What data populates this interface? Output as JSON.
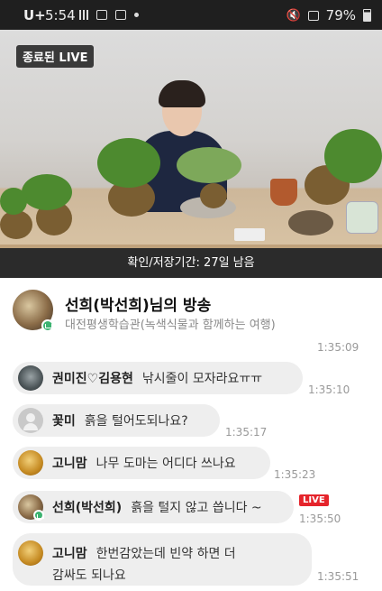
{
  "status_bar": {
    "carrier": "U+",
    "time": "5:54",
    "battery": "79%"
  },
  "video": {
    "ended_badge": "종료된 LIVE",
    "caption": "확인/저장기간: 27일 남음"
  },
  "header": {
    "title": "선희(박선희)님의 방송",
    "subtitle": "대전평생학습관(녹색식물과 함께하는 여행)"
  },
  "chat": {
    "prev_timestamp": "1:35:09",
    "messages": [
      {
        "name": "권미진♡김용현",
        "text": "낚시줄이 모자라요ㅠㅠ",
        "time": "1:35:10"
      },
      {
        "name": "꽃미",
        "text": "흙을 털어도되나요?",
        "time": "1:35:17"
      },
      {
        "name": "고니맘",
        "text": "나무 도마는 어디다 쓰나요",
        "time": "1:35:23"
      },
      {
        "name": "선희(박선희)",
        "text": "흙을 털지 않고 씁니다 ~",
        "time": "1:35:50",
        "badge": "LIVE"
      },
      {
        "name": "고니맘",
        "text": "한번감았는데 빈약 하면 더",
        "text2": "감싸도 되나요",
        "time": "1:35:51"
      }
    ]
  },
  "colors": {
    "live_red": "#e5242b",
    "host_green": "#3cb371",
    "bubble_bg": "#eeeeee"
  }
}
